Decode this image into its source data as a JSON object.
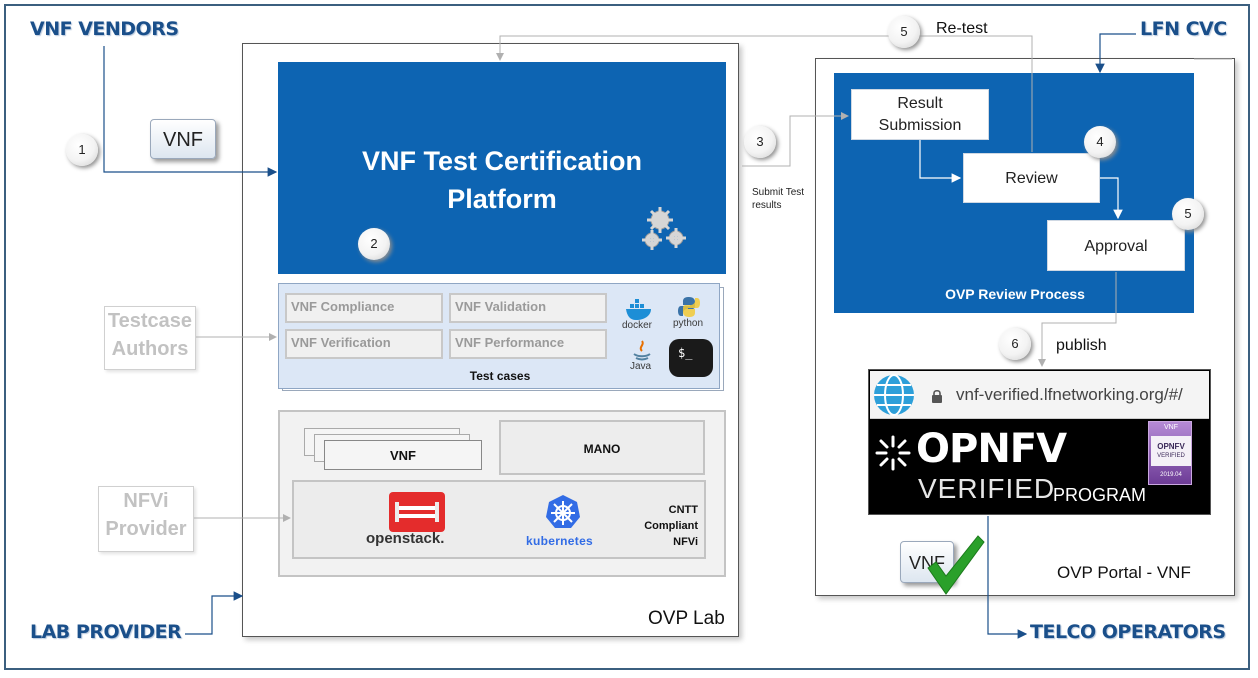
{
  "actors": {
    "vnf_vendors": "VNF VENDORS",
    "lfn_cvc": "LFN CVC",
    "testcase_authors": "Testcase\nAuthors",
    "nfvi_provider": "NFVi\nProvider",
    "lab_provider": "LAB PROVIDER",
    "telco_operators": "TELCO OPERATORS"
  },
  "steps": {
    "s1": "1",
    "s2": "2",
    "s3": "3",
    "s4": "4",
    "s5a": "5",
    "s5b": "5",
    "s6": "6"
  },
  "labels": {
    "vnf_chip": "VNF",
    "retest": "Re-test",
    "submit_test_results": "Submit Test\nresults",
    "publish": "publish"
  },
  "platform": {
    "title": "VNF Test Certification\nPlatform"
  },
  "test_cases": {
    "items": [
      "VNF Compliance",
      "VNF Validation",
      "VNF Verification",
      "VNF Performance"
    ],
    "caption": "Test cases",
    "tools": [
      "docker",
      "python",
      "Java"
    ]
  },
  "infra": {
    "vnf": "VNF",
    "mano": "MANO",
    "openstack": "openstack.",
    "kubernetes": "kubernetes",
    "cntt": "CNTT\nCompliant\nNFVi"
  },
  "lab": {
    "caption": "OVP Lab"
  },
  "review": {
    "result_submission": "Result\nSubmission",
    "review": "Review",
    "approval": "Approval",
    "caption": "OVP Review Process"
  },
  "portal": {
    "url": "vnf-verified.lfnetworking.org/#/",
    "opnfv": "OPNFV",
    "verified": "VERIFIED",
    "program": "PROGRAM",
    "badge_top": "VNF",
    "badge_mid": "OPNFV",
    "badge_sub": "VERIFIED",
    "badge_date": "2019.04",
    "vnf_chip": "VNF",
    "caption": "OVP Portal - VNF"
  },
  "colors": {
    "primary_blue": "#0d64b2",
    "actor_text": "#1a4f8a",
    "check_green": "#2aa02a"
  }
}
